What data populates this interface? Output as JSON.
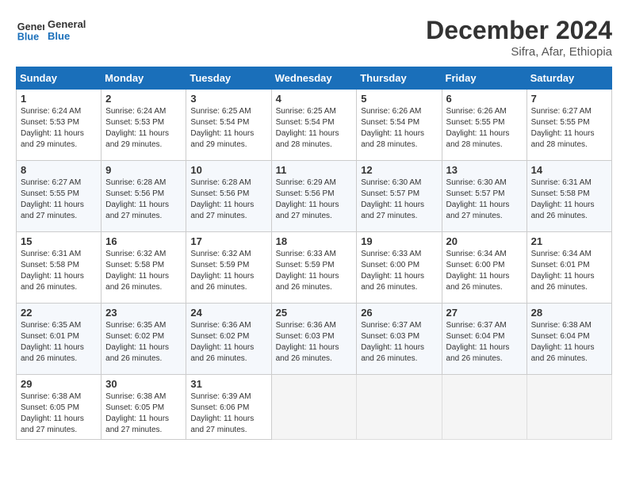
{
  "logo": {
    "text_general": "General",
    "text_blue": "Blue"
  },
  "header": {
    "month": "December 2024",
    "location": "Sifra, Afar, Ethiopia"
  },
  "weekdays": [
    "Sunday",
    "Monday",
    "Tuesday",
    "Wednesday",
    "Thursday",
    "Friday",
    "Saturday"
  ],
  "weeks": [
    [
      {
        "day": "1",
        "sunrise": "6:24 AM",
        "sunset": "5:53 PM",
        "daylight": "11 hours and 29 minutes."
      },
      {
        "day": "2",
        "sunrise": "6:24 AM",
        "sunset": "5:53 PM",
        "daylight": "11 hours and 29 minutes."
      },
      {
        "day": "3",
        "sunrise": "6:25 AM",
        "sunset": "5:54 PM",
        "daylight": "11 hours and 29 minutes."
      },
      {
        "day": "4",
        "sunrise": "6:25 AM",
        "sunset": "5:54 PM",
        "daylight": "11 hours and 28 minutes."
      },
      {
        "day": "5",
        "sunrise": "6:26 AM",
        "sunset": "5:54 PM",
        "daylight": "11 hours and 28 minutes."
      },
      {
        "day": "6",
        "sunrise": "6:26 AM",
        "sunset": "5:55 PM",
        "daylight": "11 hours and 28 minutes."
      },
      {
        "day": "7",
        "sunrise": "6:27 AM",
        "sunset": "5:55 PM",
        "daylight": "11 hours and 28 minutes."
      }
    ],
    [
      {
        "day": "8",
        "sunrise": "6:27 AM",
        "sunset": "5:55 PM",
        "daylight": "11 hours and 27 minutes."
      },
      {
        "day": "9",
        "sunrise": "6:28 AM",
        "sunset": "5:56 PM",
        "daylight": "11 hours and 27 minutes."
      },
      {
        "day": "10",
        "sunrise": "6:28 AM",
        "sunset": "5:56 PM",
        "daylight": "11 hours and 27 minutes."
      },
      {
        "day": "11",
        "sunrise": "6:29 AM",
        "sunset": "5:56 PM",
        "daylight": "11 hours and 27 minutes."
      },
      {
        "day": "12",
        "sunrise": "6:30 AM",
        "sunset": "5:57 PM",
        "daylight": "11 hours and 27 minutes."
      },
      {
        "day": "13",
        "sunrise": "6:30 AM",
        "sunset": "5:57 PM",
        "daylight": "11 hours and 27 minutes."
      },
      {
        "day": "14",
        "sunrise": "6:31 AM",
        "sunset": "5:58 PM",
        "daylight": "11 hours and 26 minutes."
      }
    ],
    [
      {
        "day": "15",
        "sunrise": "6:31 AM",
        "sunset": "5:58 PM",
        "daylight": "11 hours and 26 minutes."
      },
      {
        "day": "16",
        "sunrise": "6:32 AM",
        "sunset": "5:58 PM",
        "daylight": "11 hours and 26 minutes."
      },
      {
        "day": "17",
        "sunrise": "6:32 AM",
        "sunset": "5:59 PM",
        "daylight": "11 hours and 26 minutes."
      },
      {
        "day": "18",
        "sunrise": "6:33 AM",
        "sunset": "5:59 PM",
        "daylight": "11 hours and 26 minutes."
      },
      {
        "day": "19",
        "sunrise": "6:33 AM",
        "sunset": "6:00 PM",
        "daylight": "11 hours and 26 minutes."
      },
      {
        "day": "20",
        "sunrise": "6:34 AM",
        "sunset": "6:00 PM",
        "daylight": "11 hours and 26 minutes."
      },
      {
        "day": "21",
        "sunrise": "6:34 AM",
        "sunset": "6:01 PM",
        "daylight": "11 hours and 26 minutes."
      }
    ],
    [
      {
        "day": "22",
        "sunrise": "6:35 AM",
        "sunset": "6:01 PM",
        "daylight": "11 hours and 26 minutes."
      },
      {
        "day": "23",
        "sunrise": "6:35 AM",
        "sunset": "6:02 PM",
        "daylight": "11 hours and 26 minutes."
      },
      {
        "day": "24",
        "sunrise": "6:36 AM",
        "sunset": "6:02 PM",
        "daylight": "11 hours and 26 minutes."
      },
      {
        "day": "25",
        "sunrise": "6:36 AM",
        "sunset": "6:03 PM",
        "daylight": "11 hours and 26 minutes."
      },
      {
        "day": "26",
        "sunrise": "6:37 AM",
        "sunset": "6:03 PM",
        "daylight": "11 hours and 26 minutes."
      },
      {
        "day": "27",
        "sunrise": "6:37 AM",
        "sunset": "6:04 PM",
        "daylight": "11 hours and 26 minutes."
      },
      {
        "day": "28",
        "sunrise": "6:38 AM",
        "sunset": "6:04 PM",
        "daylight": "11 hours and 26 minutes."
      }
    ],
    [
      {
        "day": "29",
        "sunrise": "6:38 AM",
        "sunset": "6:05 PM",
        "daylight": "11 hours and 27 minutes."
      },
      {
        "day": "30",
        "sunrise": "6:38 AM",
        "sunset": "6:05 PM",
        "daylight": "11 hours and 27 minutes."
      },
      {
        "day": "31",
        "sunrise": "6:39 AM",
        "sunset": "6:06 PM",
        "daylight": "11 hours and 27 minutes."
      },
      null,
      null,
      null,
      null
    ]
  ]
}
